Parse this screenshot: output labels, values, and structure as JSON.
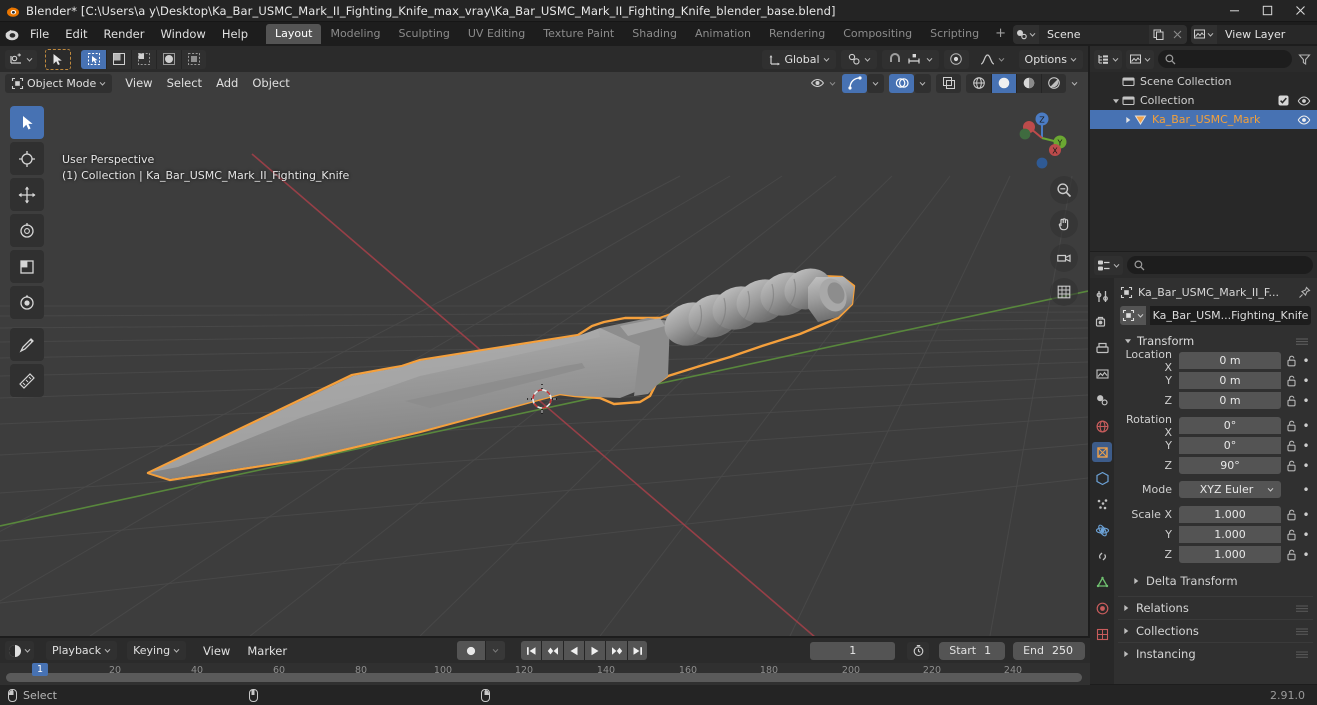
{
  "window": {
    "title": "Blender* [C:\\Users\\a y\\Desktop\\Ka_Bar_USMC_Mark_II_Fighting_Knife_max_vray\\Ka_Bar_USMC_Mark_II_Fighting_Knife_blender_base.blend]",
    "minimize": "minimize-icon",
    "maximize": "maximize-icon",
    "close": "close-icon"
  },
  "menus": [
    "File",
    "Edit",
    "Render",
    "Window",
    "Help"
  ],
  "workspace_tabs": [
    {
      "label": "Layout",
      "active": true
    },
    {
      "label": "Modeling",
      "active": false
    },
    {
      "label": "Sculpting",
      "active": false
    },
    {
      "label": "UV Editing",
      "active": false
    },
    {
      "label": "Texture Paint",
      "active": false
    },
    {
      "label": "Shading",
      "active": false
    },
    {
      "label": "Animation",
      "active": false
    },
    {
      "label": "Rendering",
      "active": false
    },
    {
      "label": "Compositing",
      "active": false
    },
    {
      "label": "Scripting",
      "active": false
    }
  ],
  "workspace_add": "+",
  "topbar_right": {
    "scene_name": "Scene",
    "view_layer_name": "View Layer",
    "new_label": "new-scene-icon",
    "remove_label": "remove-icon"
  },
  "viewport": {
    "mode": "Object Mode",
    "menus": [
      "View",
      "Select",
      "Add",
      "Object"
    ],
    "transform_orientation": "Global",
    "options_label": "Options",
    "overlay_line1": "User Perspective",
    "overlay_line2": "(1) Collection | Ka_Bar_USMC_Mark_II_Fighting_Knife",
    "axis_labels": {
      "x": "X",
      "y": "Y",
      "z": "Z"
    },
    "select_modes": [
      "tweak-select-icon",
      "box-select-icon",
      "circle-select-icon",
      "lasso-select-icon"
    ],
    "tools": [
      "select-box-tool",
      "cursor-tool",
      "move-tool",
      "rotate-tool",
      "scale-tool",
      "transform-tool",
      "annotate-tool",
      "measure-tool"
    ],
    "gizmo_buttons": [
      "zoom-icon",
      "pan-icon",
      "camera-view-icon",
      "toggle-ortho-icon"
    ],
    "shading_modes": [
      "wireframe-shading",
      "solid-shading",
      "material-preview-shading",
      "rendered-shading"
    ],
    "selected_object_outline_color": "#f5a03c"
  },
  "outliner": {
    "display_mode": "View Layer",
    "search_placeholder": "",
    "filter_icon": "filter-icon",
    "rows": [
      {
        "label": "Scene Collection",
        "indent": 0,
        "icon": "collection-icon",
        "expanded": null,
        "checkbox": false,
        "eye": false,
        "selected": false
      },
      {
        "label": "Collection",
        "indent": 1,
        "icon": "collection-icon",
        "expanded": true,
        "checkbox": true,
        "eye": true,
        "selected": false
      },
      {
        "label": "Ka_Bar_USMC_Mark",
        "indent": 2,
        "icon": "mesh-object-icon",
        "expanded": false,
        "checkbox": false,
        "eye": true,
        "selected": true
      }
    ]
  },
  "properties": {
    "editor_type": "properties-editor-icon",
    "search_placeholder": "",
    "breadcrumb": "Ka_Bar_USMC_Mark_II_F...",
    "object_name": "Ka_Bar_USM...Fighting_Knife",
    "pin_icon": "pin-icon",
    "tabs": [
      "tool-tab",
      "render-tab",
      "output-tab",
      "view-layer-tab",
      "scene-tab",
      "world-tab",
      "object-tab",
      "modifiers-tab",
      "particles-tab",
      "physics-tab",
      "constraints-tab",
      "data-tab",
      "material-tab",
      "texture-tab"
    ],
    "active_tab_index": 6,
    "transform": {
      "title": "Transform",
      "location": {
        "label": "Location X",
        "sub": [
          "Y",
          "Z"
        ],
        "values": [
          "0 m",
          "0 m",
          "0 m"
        ]
      },
      "rotation": {
        "label": "Rotation X",
        "sub": [
          "Y",
          "Z"
        ],
        "values": [
          "0°",
          "0°",
          "90°"
        ]
      },
      "mode": {
        "label": "Mode",
        "value": "XYZ Euler"
      },
      "scale": {
        "label": "Scale X",
        "sub": [
          "Y",
          "Z"
        ],
        "values": [
          "1.000",
          "1.000",
          "1.000"
        ]
      },
      "delta_transform": "Delta Transform"
    },
    "collapsed_panels": [
      "Relations",
      "Collections",
      "Instancing"
    ]
  },
  "timeline": {
    "editor_icon": "timeline-editor-icon",
    "menus": [
      "Playback",
      "Keying",
      "View",
      "Marker"
    ],
    "record_icon": "auto-keying-icon",
    "transport": [
      "jump-to-start-icon",
      "jump-to-prev-keyframe-icon",
      "play-reverse-icon",
      "play-icon",
      "jump-to-next-keyframe-icon",
      "jump-to-end-icon"
    ],
    "current_frame": "1",
    "range_icon": "use-preview-range-icon",
    "start_label": "Start",
    "start_value": "1",
    "end_label": "End",
    "end_value": "250",
    "ticks": [
      "20",
      "40",
      "60",
      "80",
      "100",
      "120",
      "140",
      "160",
      "180",
      "200",
      "220",
      "240"
    ],
    "playhead_label": "1"
  },
  "statusbar": {
    "lmb_action": "Select",
    "mmb_action": "",
    "rmb_action": "",
    "version": "2.91.0"
  },
  "colors": {
    "accent_blue": "#4772b3",
    "selection_orange": "#f5a03c",
    "viewport_bg": "#3d3d3d",
    "panel_bg": "#303030",
    "header_bg": "#2b2b2b"
  }
}
